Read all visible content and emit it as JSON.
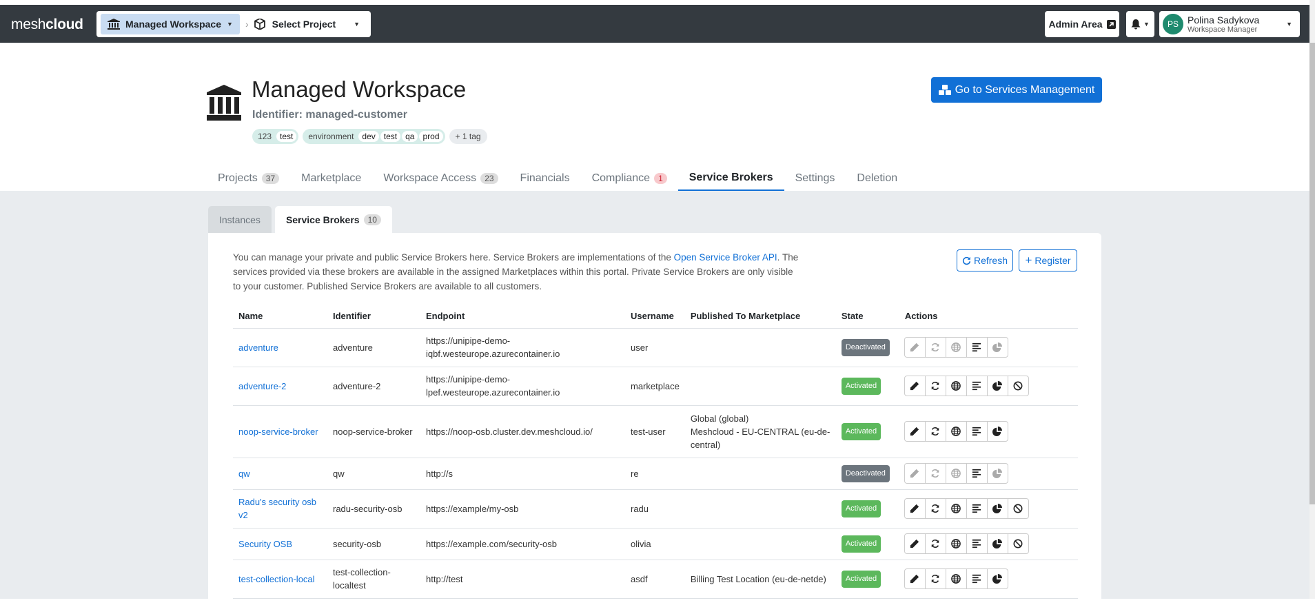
{
  "navbar": {
    "logo_thin": "mesh",
    "logo_bold": "cloud",
    "workspace_selector": "Managed Workspace",
    "project_selector": "Select Project",
    "admin_area": "Admin Area",
    "user_name": "Polina Sadykova",
    "user_role": "Workspace Manager",
    "user_initials": "PS"
  },
  "header": {
    "title": "Managed Workspace",
    "identifier": "Identifier: managed-customer",
    "tags": [
      {
        "key": "123",
        "values": [
          "test"
        ]
      },
      {
        "key": "environment",
        "values": [
          "dev",
          "test",
          "qa",
          "prod"
        ]
      }
    ],
    "more_tags": "+ 1 tag",
    "services_button": "Go to Services Management"
  },
  "tabs": [
    {
      "label": "Projects",
      "count": "37"
    },
    {
      "label": "Marketplace"
    },
    {
      "label": "Workspace Access",
      "count": "23"
    },
    {
      "label": "Financials"
    },
    {
      "label": "Compliance",
      "count": "1"
    },
    {
      "label": "Service Brokers"
    },
    {
      "label": "Settings"
    },
    {
      "label": "Deletion"
    }
  ],
  "subtabs": [
    {
      "label": "Instances"
    },
    {
      "label": "Service Brokers",
      "count": "10"
    }
  ],
  "intro": {
    "line1": "You can manage your private and public Service Brokers here. Service Brokers are implementations of the ",
    "link": "Open Service Broker API",
    "line1_end": ".",
    "rest": "The services provided via these brokers are available in the assigned Marketplaces within this portal. Private Service Brokers are only visible to your customer. Published Service Brokers are available to all customers."
  },
  "buttons": {
    "refresh": "Refresh",
    "register": "Register"
  },
  "table": {
    "headers": [
      "Name",
      "Identifier",
      "Endpoint",
      "Username",
      "Published To Marketplace",
      "State",
      "Actions"
    ],
    "rows": [
      {
        "name": "adventure",
        "identifier": "adventure",
        "endpoint": "https://unipipe-demo-iqbf.westeurope.azurecontainer.io",
        "username": "user",
        "published": "",
        "state": "Deactivated",
        "disable": false
      },
      {
        "name": "adventure-2",
        "identifier": "adventure-2",
        "endpoint": "https://unipipe-demo-lpef.westeurope.azurecontainer.io",
        "username": "marketplace",
        "published": "",
        "state": "Activated",
        "disable": true
      },
      {
        "name": "noop-service-broker",
        "identifier": "noop-service-broker",
        "endpoint": "https://noop-osb.cluster.dev.meshcloud.io/",
        "username": "test-user",
        "published": "Global (global)\nMeshcloud - EU-CENTRAL (eu-de-central)",
        "state": "Activated",
        "disable": false
      },
      {
        "name": "qw",
        "identifier": "qw",
        "endpoint": "http://s",
        "username": "re",
        "published": "",
        "state": "Deactivated",
        "disable": false
      },
      {
        "name": "Radu's security osb v2",
        "identifier": "radu-security-osb",
        "endpoint": "https://example/my-osb",
        "username": "radu",
        "published": "",
        "state": "Activated",
        "disable": true
      },
      {
        "name": "Security OSB",
        "identifier": "security-osb",
        "endpoint": "https://example.com/security-osb",
        "username": "olivia",
        "published": "",
        "state": "Activated",
        "disable": true
      },
      {
        "name": "test-collection-local",
        "identifier": "test-collection-localtest",
        "endpoint": "http://test",
        "username": "asdf",
        "published": "Billing Test Location (eu-de-netde)",
        "state": "Activated",
        "disable": false
      }
    ]
  },
  "colors": {
    "navbar": "#343a40",
    "accent": "#1170d6",
    "activated": "#5cb85c",
    "deactivated": "#6c757d"
  }
}
